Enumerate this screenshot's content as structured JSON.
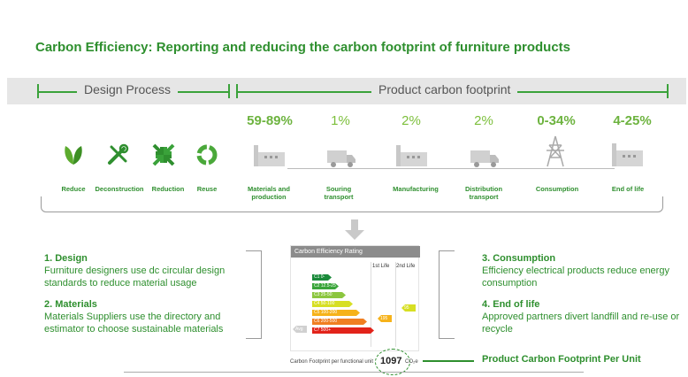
{
  "title": "Carbon Efficiency: Reporting and reducing the carbon footprint of furniture products",
  "band": {
    "design_process": "Design Process",
    "product_footprint": "Product carbon footprint"
  },
  "design_steps": [
    {
      "label": "Reduce",
      "icon": "leaves-icon"
    },
    {
      "label": "Deconstruction",
      "icon": "tools-icon"
    },
    {
      "label": "Reduction",
      "icon": "arrows-inward-icon"
    },
    {
      "label": "Reuse",
      "icon": "recycle-icon"
    }
  ],
  "footprint_steps": [
    {
      "percent": "59-89%",
      "label": "Materials and production",
      "icon": "factory-icon"
    },
    {
      "percent": "1%",
      "label": "Souring transport",
      "icon": "truck-icon"
    },
    {
      "percent": "2%",
      "label": "Manufacturing",
      "icon": "factory-icon"
    },
    {
      "percent": "2%",
      "label": "Distribution transport",
      "icon": "truck-icon"
    },
    {
      "percent": "0-34%",
      "label": "Consumption",
      "icon": "power-tower-icon"
    },
    {
      "percent": "4-25%",
      "label": "End of life",
      "icon": "factory-icon"
    }
  ],
  "notes_left": [
    {
      "heading": "1. Design",
      "body": "Furniture designers use dc circular design standards to reduce material usage"
    },
    {
      "heading": "2. Materials",
      "body": "Materials Suppliers use the directory and estimator to choose sustainable materials"
    }
  ],
  "notes_right": [
    {
      "heading": "3. Consumption",
      "body": "Efficiency electrical products reduce energy consumption"
    },
    {
      "heading": "4. End of life",
      "body": "Approved partners divert landfill and re-use or recycle"
    }
  ],
  "rating": {
    "header": "Carbon Efficiency Rating",
    "first_life": "1st Life",
    "second_life": "2nd Life",
    "bands": [
      {
        "label": "C1  0-12.5",
        "color": "#1a8a3a"
      },
      {
        "label": "C2  12.5-25",
        "color": "#3aa53a"
      },
      {
        "label": "C3  25-50",
        "color": "#8cc63f"
      },
      {
        "label": "C4  50-100",
        "color": "#d7df23"
      },
      {
        "label": "C5  100-200",
        "color": "#f6b21a"
      },
      {
        "label": "C6  200-500",
        "color": "#f07f22"
      },
      {
        "label": "C7  500+",
        "color": "#e2231a"
      }
    ],
    "avg_label": "Avg",
    "first_value": "195",
    "second_value": "95",
    "footer_label": "Carbon Footprint per functional unit",
    "footer_value": "1097",
    "footer_unit": "CO₂e"
  },
  "product_label": "Product Carbon Footprint Per Unit",
  "colors": {
    "brand_green": "#2e8f2e",
    "light_green": "#7cbf3b"
  }
}
